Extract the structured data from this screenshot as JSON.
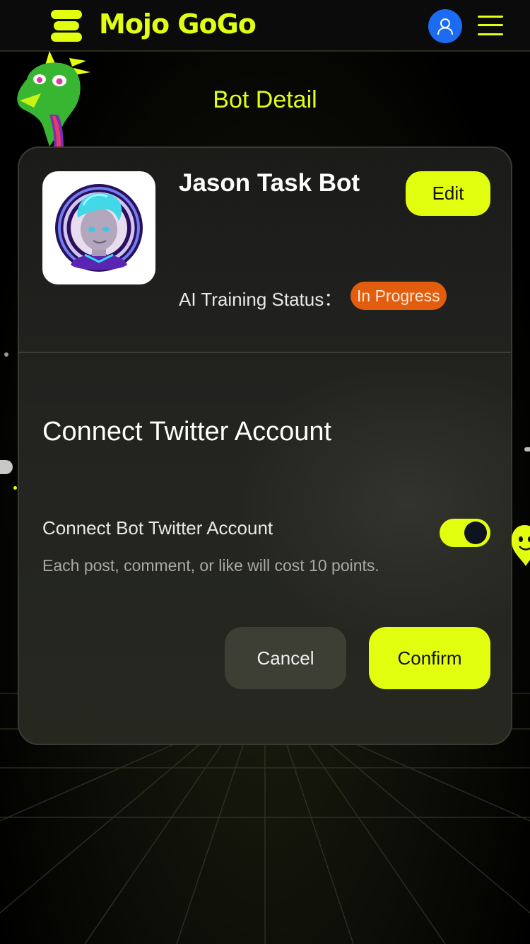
{
  "brand": {
    "name": "Mojo GoGo",
    "accent_color": "#e2ff10"
  },
  "header": {
    "user_icon": "user-icon",
    "menu_icon": "hamburger-menu-icon"
  },
  "page": {
    "title": "Bot Detail"
  },
  "bot": {
    "name": "Jason Task Bot",
    "edit_label": "Edit",
    "status_label": "AI Training Status：",
    "status_value": "In Progress",
    "status_color": "#e25d0e"
  },
  "connect": {
    "title": "Connect Twitter Account",
    "toggle_label": "Connect Bot Twitter Account",
    "toggle_on": true,
    "hint": "Each post, comment, or like will cost 10 points.",
    "cancel_label": "Cancel",
    "confirm_label": "Confirm"
  }
}
